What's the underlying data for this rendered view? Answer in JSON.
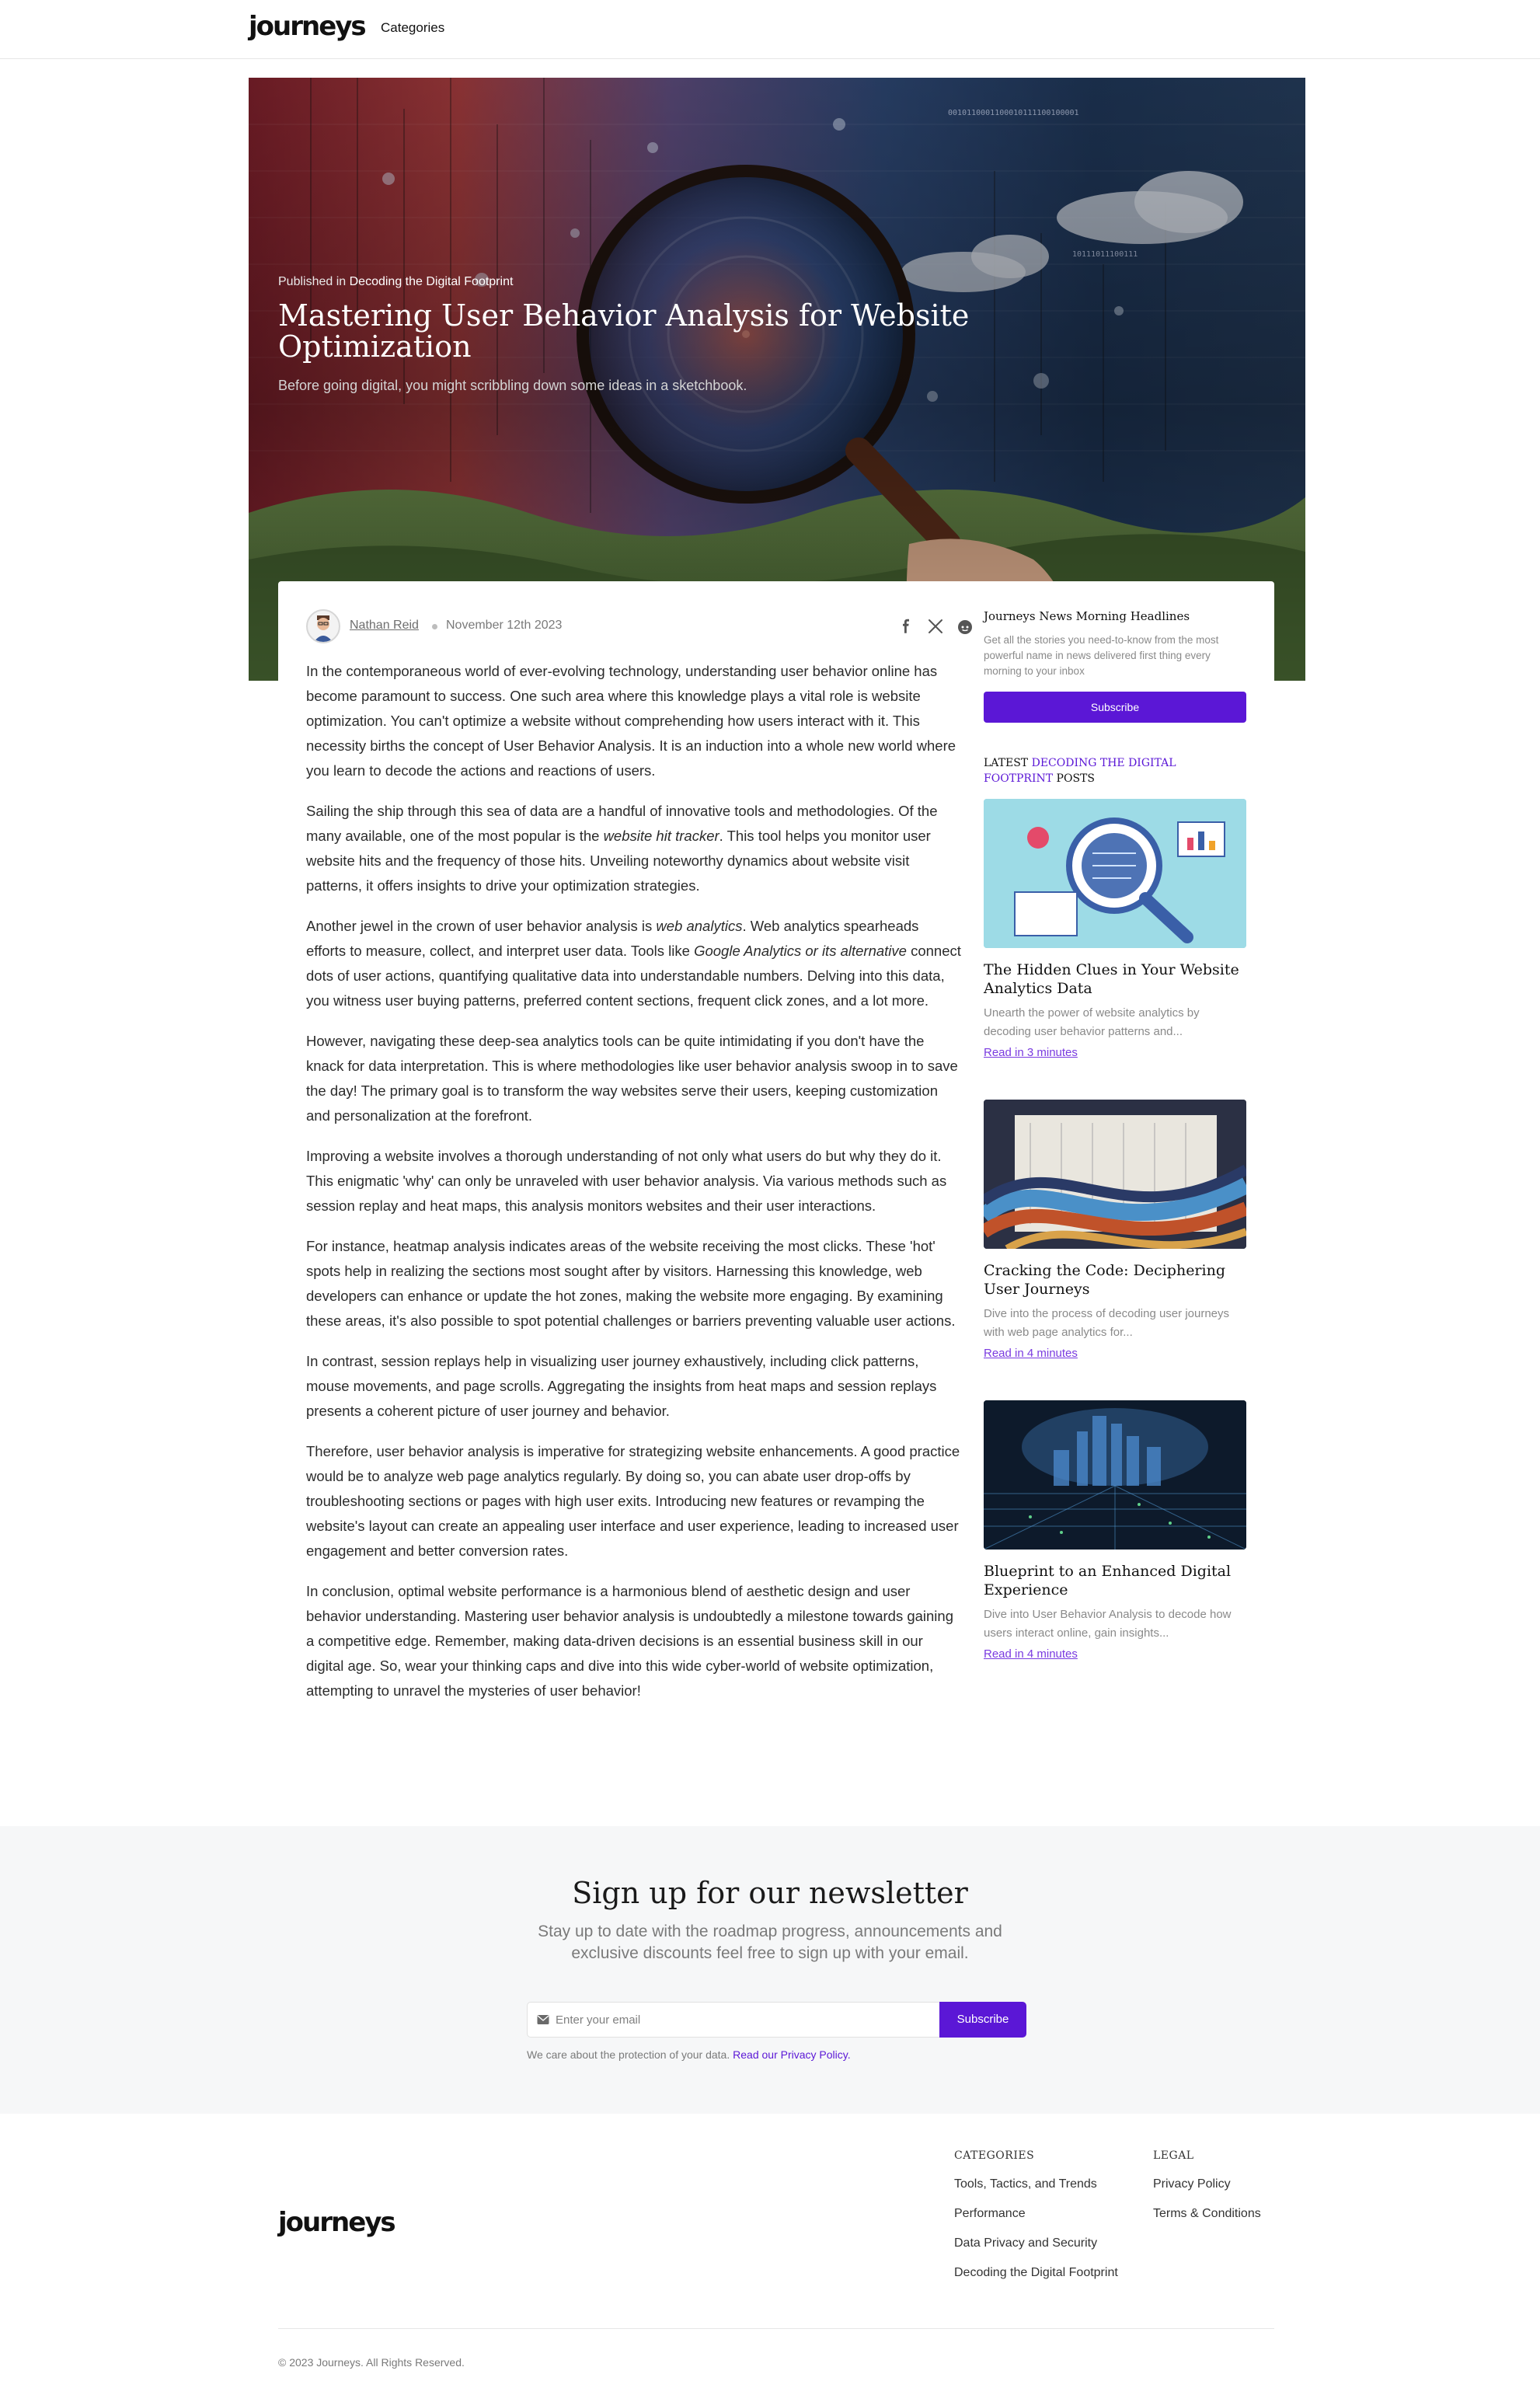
{
  "header": {
    "logo": "journeys",
    "nav_categories": "Categories"
  },
  "hero": {
    "published_prefix": "Published in",
    "category": "Decoding the Digital Footprint",
    "title": "Mastering User Behavior Analysis for Website Optimization",
    "subtitle": "Before going digital, you might scribbling down some ideas in a sketchbook.",
    "binary_1": "0010110001100010111100100001",
    "binary_2": "10111011100111"
  },
  "meta": {
    "author": "Nathan Reid",
    "date": "November 12th 2023"
  },
  "article": {
    "p1": "In the contemporaneous world of ever-evolving technology, understanding user behavior online has become paramount to success. One such area where this knowledge plays a vital role is website optimization. You can't optimize a website without comprehending how users interact with it. This necessity births the concept of User Behavior Analysis. It is an induction into a whole new world where you learn to decode the actions and reactions of users.",
    "p2_a": "Sailing the ship through this sea of data are a handful of innovative tools and methodologies. Of the many available, one of the most popular is the ",
    "p2_em": "website hit tracker",
    "p2_b": ". This tool helps you monitor user website hits and the frequency of those hits. Unveiling noteworthy dynamics about website visit patterns, it offers insights to drive your optimization strategies.",
    "p3_a": "Another jewel in the crown of user behavior analysis is ",
    "p3_em1": "web analytics",
    "p3_b": ". Web analytics spearheads efforts to measure, collect, and interpret user data. Tools like ",
    "p3_em2": "Google Analytics or its alternative",
    "p3_c": " connect dots of user actions, quantifying qualitative data into understandable numbers. Delving into this data, you witness user buying patterns, preferred content sections, frequent click zones, and a lot more.",
    "p4": "However, navigating these deep-sea analytics tools can be quite intimidating if you don't have the knack for data interpretation. This is where methodologies like user behavior analysis swoop in to save the day! The primary goal is to transform the way websites serve their users, keeping customization and personalization at the forefront.",
    "p5": "Improving a website involves a thorough understanding of not only what users do but why they do it. This enigmatic 'why' can only be unraveled with user behavior analysis. Via various methods such as session replay and heat maps, this analysis monitors websites and their user interactions.",
    "p6": "For instance, heatmap analysis indicates areas of the website receiving the most clicks. These 'hot' spots help in realizing the sections most sought after by visitors. Harnessing this knowledge, web developers can enhance or update the hot zones, making the website more engaging. By examining these areas, it's also possible to spot potential challenges or barriers preventing valuable user actions.",
    "p7": "In contrast, session replays help in visualizing user journey exhaustively, including click patterns, mouse movements, and page scrolls. Aggregating the insights from heat maps and session replays presents a coherent picture of user journey and behavior.",
    "p8": "Therefore, user behavior analysis is imperative for strategizing website enhancements. A good practice would be to analyze web page analytics regularly. By doing so, you can abate user drop-offs by troubleshooting sections or pages with high user exits. Introducing new features or revamping the website's layout can create an appealing user interface and user experience, leading to increased user engagement and better conversion rates.",
    "p9": "In conclusion, optimal website performance is a harmonious blend of aesthetic design and user behavior understanding. Mastering user behavior analysis is undoubtedly a milestone towards gaining a competitive edge. Remember, making data-driven decisions is an essential business skill in our digital age. So, wear your thinking caps and dive into this wide cyber-world of website optimization, attempting to unravel the mysteries of user behavior!"
  },
  "sidebar": {
    "heading": "Journeys News Morning Headlines",
    "text": "Get all the stories you need-to-know from the most powerful name in news delivered first thing every morning to your inbox",
    "subscribe": "Subscribe",
    "latest_prefix": "LATEST",
    "latest_category": "DECODING THE DIGITAL FOOTPRINT",
    "latest_suffix": "POSTS",
    "posts": [
      {
        "title": "The Hidden Clues in Your Website Analytics Data",
        "excerpt": "Unearth the power of website analytics by decoding user behavior patterns and...",
        "read": "Read in 3 minutes"
      },
      {
        "title": "Cracking the Code: Deciphering User Journeys",
        "excerpt": "Dive into the process of decoding user journeys with web page analytics for...",
        "read": "Read in 4 minutes"
      },
      {
        "title": "Blueprint to an Enhanced Digital Experience",
        "excerpt": "Dive into User Behavior Analysis to decode how users interact online, gain insights...",
        "read": "Read in 4 minutes"
      }
    ]
  },
  "newsletter": {
    "title": "Sign up for our newsletter",
    "text": "Stay up to date with the roadmap progress, announcements and exclusive discounts feel free to sign up with your email.",
    "placeholder": "Enter your email",
    "button": "Subscribe",
    "note": "We care about the protection of your data.",
    "note_link": "Read our Privacy Policy."
  },
  "footer": {
    "logo": "journeys",
    "categories_heading": "CATEGORIES",
    "categories": [
      "Tools, Tactics, and Trends",
      "Performance",
      "Data Privacy and Security",
      "Decoding the Digital Footprint"
    ],
    "legal_heading": "LEGAL",
    "legal": [
      "Privacy Policy",
      "Terms & Conditions"
    ],
    "copyright": "© 2023 Journeys. All Rights Reserved."
  },
  "colors": {
    "accent": "#5b17d6",
    "link": "#7a3be0",
    "newsletter_bg": "#f6f7f8"
  }
}
